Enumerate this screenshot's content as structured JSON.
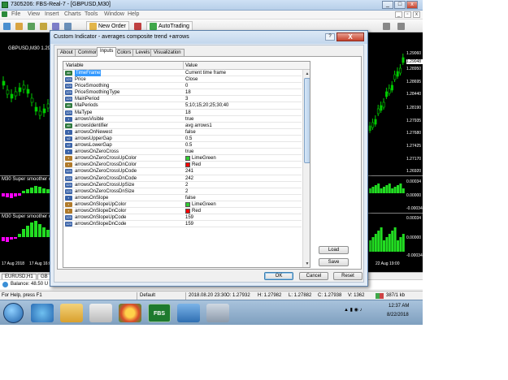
{
  "window": {
    "title": "7305206: FBS-Real-7 - [GBPUSD,M30]"
  },
  "menu": {
    "items": [
      "File",
      "View",
      "Insert",
      "Charts",
      "Tools",
      "Window",
      "Help"
    ]
  },
  "toolbar": {
    "new_order": "New Order",
    "autotrading": "AutoTrading"
  },
  "chart": {
    "title": "GBPUSD,M30  1.2930",
    "subwindow1_title": "M30 Super smoother com",
    "subwindow2_title": "M30 Super smoother com",
    "price_ticks": [
      "1.29060",
      "1.29048",
      "1.28950",
      "1.28695",
      "1.28440",
      "1.28190",
      "1.27935",
      "1.27680",
      "1.27425",
      "1.27170",
      "1.26920"
    ],
    "current_price": "1.29048",
    "sub1_ticks": [
      "0.00034",
      "0.00000",
      "-0.00034"
    ],
    "sub2_ticks": [
      "0.00034",
      "0.00000",
      "-0.00034"
    ],
    "date_left": [
      "17 Aug 2018",
      "17 Aug 16:00"
    ],
    "date_right": "22 Aug 19:00"
  },
  "chart_tabs": [
    "EURUSD,H1",
    "GB"
  ],
  "balance": "Balance: 48.50 U",
  "status": {
    "help": "For Help, press F1",
    "profile": "Default",
    "datetime": "2018.08.20 23:30",
    "open": "O: 1.27932",
    "high": "H: 1.27982",
    "low": "L: 1.27882",
    "close": "C: 1.27938",
    "volume": "V: 1362",
    "traffic": "387/1 kb"
  },
  "taskbar": {
    "clock_time": "12:37 AM",
    "clock_date": "8/22/2018",
    "fbs_label": "FBS"
  },
  "dialog": {
    "title": "Custom Indicator - averages composite trend +arrows",
    "help_label": "?",
    "close_label": "X",
    "tabs": [
      "About",
      "Common",
      "Inputs",
      "Colors",
      "Levels",
      "Visualization"
    ],
    "active_tab": "Inputs",
    "columns": {
      "variable": "Variable",
      "value": "Value"
    },
    "rows": [
      {
        "icon": "ab",
        "name": "TimeFrame",
        "value": "Current time frame"
      },
      {
        "icon": "123",
        "name": "Price",
        "value": "Close"
      },
      {
        "icon": "123",
        "name": "PriceSmoothing",
        "value": "0"
      },
      {
        "icon": "123",
        "name": "PriceSmoothingType",
        "value": "18"
      },
      {
        "icon": "123",
        "name": "MainPeriod",
        "value": "3"
      },
      {
        "icon": "ab",
        "name": "MaPeriods",
        "value": "5;10;15;20;25;30;40"
      },
      {
        "icon": "123",
        "name": "MaType",
        "value": "18"
      },
      {
        "icon": "bool",
        "name": "arrowsVisible",
        "value": "true"
      },
      {
        "icon": "ab",
        "name": "arrowsIdentifier",
        "value": "avg arrows1"
      },
      {
        "icon": "bool",
        "name": "arrowsOnNewest",
        "value": "false"
      },
      {
        "icon": "v2",
        "name": "arrowsUpperGap",
        "value": "0.5"
      },
      {
        "icon": "v2",
        "name": "arrowsLowerGap",
        "value": "0.5"
      },
      {
        "icon": "bool",
        "name": "arrowsOnZeroCross",
        "value": "true"
      },
      {
        "icon": "clr",
        "name": "arrowsOnZeroCrossUpColor",
        "value": "LimeGreen",
        "swatch": "#32cd32"
      },
      {
        "icon": "clr",
        "name": "arrowsOnZeroCrossDnColor",
        "value": "Red",
        "swatch": "#ff0000"
      },
      {
        "icon": "123",
        "name": "arrowsOnZeroCrossUpCode",
        "value": "241"
      },
      {
        "icon": "123",
        "name": "arrowsOnZeroCrossDnCode",
        "value": "242"
      },
      {
        "icon": "123",
        "name": "arrowsOnZeroCrossUpSize",
        "value": "2"
      },
      {
        "icon": "123",
        "name": "arrowsOnZeroCrossDnSize",
        "value": "2"
      },
      {
        "icon": "bool",
        "name": "arrowsOnSlope",
        "value": "false"
      },
      {
        "icon": "clr",
        "name": "arrowsOnSlopeUpColor",
        "value": "LimeGreen",
        "swatch": "#32cd32"
      },
      {
        "icon": "clr",
        "name": "arrowsOnSlopeDnColor",
        "value": "Red",
        "swatch": "#ff0000"
      },
      {
        "icon": "123",
        "name": "arrowsOnSlopeUpCode",
        "value": "159"
      },
      {
        "icon": "123",
        "name": "arrowsOnSlopeDnCode",
        "value": "159"
      }
    ],
    "load_label": "Load",
    "save_label": "Save",
    "ok_label": "OK",
    "cancel_label": "Cancel",
    "reset_label": "Reset"
  },
  "colors": {
    "histogram_green": "#22dd22",
    "histogram_magenta": "#ff00ff",
    "candle_green": "#00cc00",
    "chart_bg": "#000000",
    "selection": "#3399ff"
  }
}
